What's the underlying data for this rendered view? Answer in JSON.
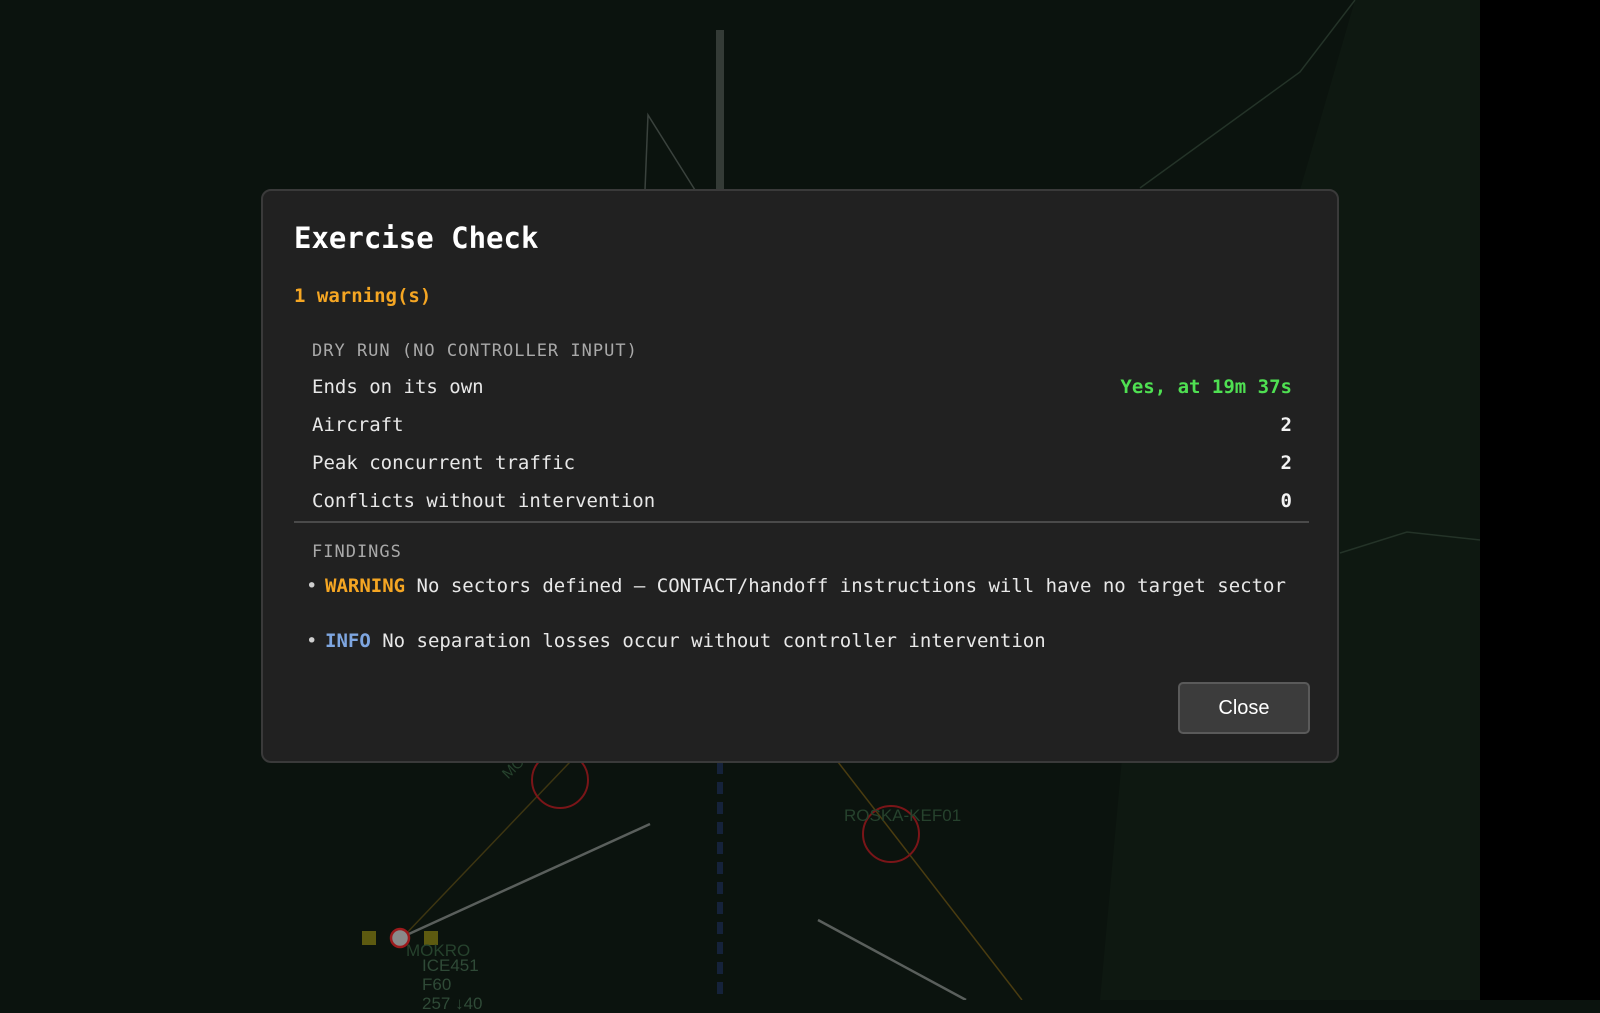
{
  "colors": {
    "background": "#0b130e",
    "modal_background": "#212121",
    "warning": "#f5a623",
    "info": "#7ea6e0",
    "ok": "#4fe052",
    "conflict_ring": "#b0191c"
  },
  "radar": {
    "fixes": [
      {
        "name": "ROSKA-KEF01"
      },
      {
        "name": "MOKRO"
      },
      {
        "name": "MOKRO"
      }
    ],
    "aircraft": [
      {
        "callsign": "ICE451",
        "altitude": "F60",
        "speed_line": "257 ↓40"
      }
    ]
  },
  "modal": {
    "title": "Exercise Check",
    "summary": "1 warning(s)",
    "dry_run": {
      "heading": "DRY RUN (NO CONTROLLER INPUT)",
      "rows": [
        {
          "label": "Ends on its own",
          "value": "Yes, at 19m 37s",
          "status": "ok"
        },
        {
          "label": "Aircraft",
          "value": "2",
          "status": "normal"
        },
        {
          "label": "Peak concurrent traffic",
          "value": "2",
          "status": "normal"
        },
        {
          "label": "Conflicts without intervention",
          "value": "0",
          "status": "normal"
        }
      ]
    },
    "findings": {
      "heading": "FINDINGS",
      "items": [
        {
          "severity": "WARNING",
          "text": "No sectors defined — CONTACT/handoff instructions will have no target sector"
        },
        {
          "severity": "INFO",
          "text": "No separation losses occur without controller intervention"
        }
      ]
    },
    "close_label": "Close"
  }
}
